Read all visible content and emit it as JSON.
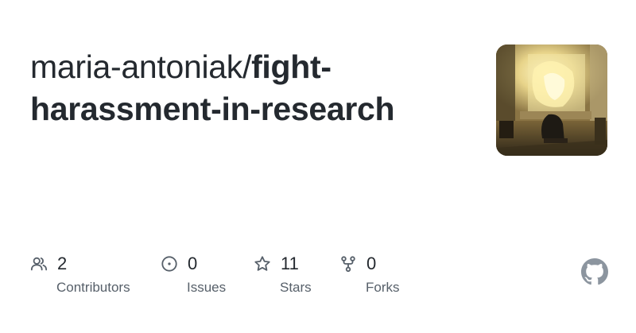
{
  "repo": {
    "owner": "maria-antoniak/",
    "name": "fight-harassment-in-research"
  },
  "stats": [
    {
      "icon": "contributors-icon",
      "value": "2",
      "label": "Contributors"
    },
    {
      "icon": "issues-icon",
      "value": "0",
      "label": "Issues"
    },
    {
      "icon": "star-icon",
      "value": "11",
      "label": "Stars"
    },
    {
      "icon": "fork-icon",
      "value": "0",
      "label": "Forks"
    }
  ],
  "colors": {
    "text": "#24292f",
    "muted": "#57606a",
    "logo": "#8c959f"
  }
}
